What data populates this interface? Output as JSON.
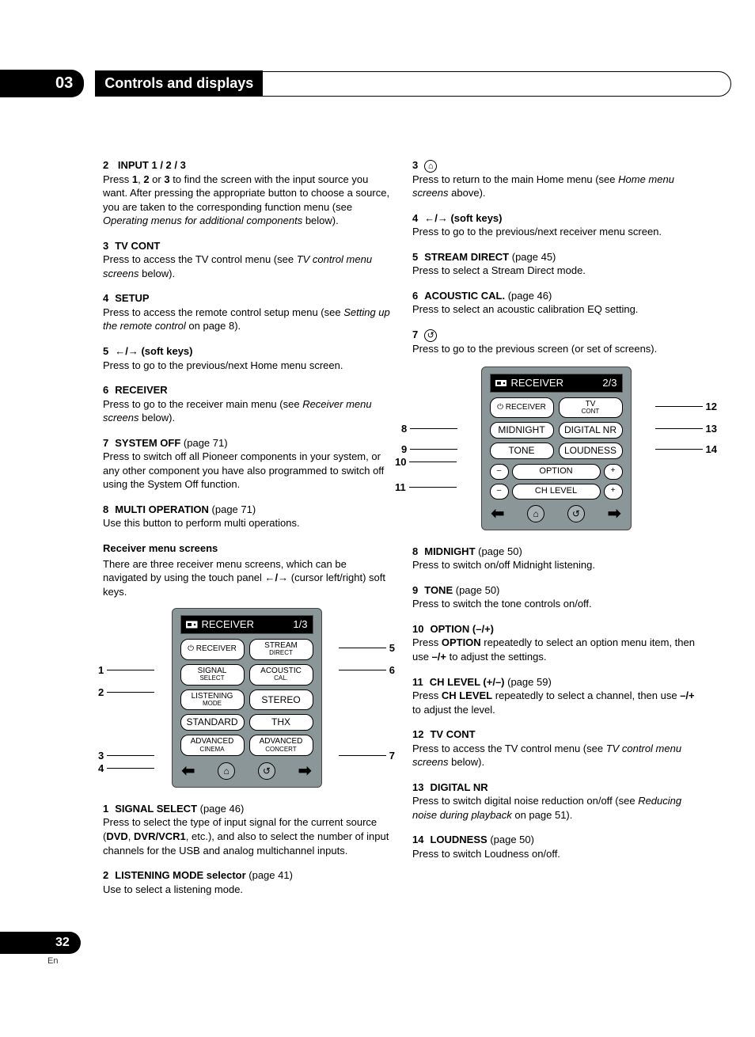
{
  "header": {
    "chapter_number": "03",
    "chapter_title": "Controls and displays"
  },
  "footer": {
    "page_number": "32",
    "lang": "En"
  },
  "left_col": {
    "i2": {
      "num": "2",
      "title": "INPUT 1 / 2 / 3",
      "body_a": "Press ",
      "b1": "1",
      "sep1": ", ",
      "b2": "2",
      "sep2": " or ",
      "b3": "3",
      "body_b": " to find the screen with the input source you want. After pressing the appropriate button to choose a source, you are taken to the corresponding function menu (see ",
      "ital": "Operating menus for additional components",
      "body_c": " below)."
    },
    "i3": {
      "num": "3",
      "title": "TV CONT",
      "body_a": "Press to access the TV control menu (see ",
      "ital": "TV control menu screens",
      "body_b": " below)."
    },
    "i4": {
      "num": "4",
      "title": "SETUP",
      "body_a": "Press to access the remote control setup menu (see ",
      "ital": "Setting up the remote control",
      "body_b": " on page 8)."
    },
    "i5": {
      "num": "5",
      "arrows": "←/→",
      "title_suffix": " (soft keys)",
      "body": "Press to go to the previous/next Home menu screen."
    },
    "i6": {
      "num": "6",
      "title": "RECEIVER",
      "body_a": "Press to go to the receiver main menu (see ",
      "ital": "Receiver menu screens",
      "body_b": " below)."
    },
    "i7": {
      "num": "7",
      "title": "SYSTEM OFF",
      "ref": " (page 71)",
      "body": "Press to switch off all Pioneer components in your system, or any other component you have also programmed to switch off using the System Off function."
    },
    "i8": {
      "num": "8",
      "title": "MULTI OPERATION",
      "ref": " (page 71)",
      "body": "Use this button to perform multi operations."
    },
    "section": {
      "title": "Receiver menu screens",
      "body_a": "There are three receiver menu screens, which can be navigated by using the touch panel ",
      "arrows": "←/→",
      "body_b": " (cursor left/right) soft keys."
    },
    "remote1": {
      "title": "RECEIVER",
      "page": "1/3",
      "btns": {
        "receiver": "RECEIVER",
        "stream_direct_a": "STREAM",
        "stream_direct_b": "DIRECT",
        "signal_select_a": "SIGNAL",
        "signal_select_b": "SELECT",
        "acoustic_cal_a": "ACOUSTIC",
        "acoustic_cal_b": "CAL.",
        "listening_mode_a": "LISTENING",
        "listening_mode_b": "MODE",
        "stereo": "STEREO",
        "standard": "STANDARD",
        "thx": "THX",
        "adv_cinema_a": "ADVANCED",
        "adv_cinema_b": "CINEMA",
        "adv_concert_a": "ADVANCED",
        "adv_concert_b": "CONCERT"
      },
      "callouts": {
        "c1": "1",
        "c2": "2",
        "c3": "3",
        "c4": "4",
        "c5": "5",
        "c6": "6",
        "c7": "7"
      }
    },
    "after_remote": {
      "i1": {
        "num": "1",
        "title": "SIGNAL SELECT",
        "ref": " (page 46)",
        "body_a": "Press to select the type of input signal for the current source (",
        "b1": "DVD",
        "sep1": ", ",
        "b2": "DVR/VCR1",
        "body_b": ", etc.), and also to select the number of input channels for the USB and analog multichannel inputs."
      },
      "i2b": {
        "num": "2",
        "title": "LISTENING MODE selector",
        "ref": " (page 41)",
        "body": "Use to select a listening mode."
      }
    }
  },
  "right_col": {
    "i3": {
      "num": "3",
      "body_a": "Press to return to the main Home menu (see ",
      "ital": "Home menu screens",
      "body_b": " above)."
    },
    "i4": {
      "num": "4",
      "arrows": "←/→",
      "title_suffix": " (soft keys)",
      "body": "Press to go to the previous/next receiver menu screen."
    },
    "i5": {
      "num": "5",
      "title": "STREAM DIRECT",
      "ref": " (page 45)",
      "body": "Press to select a Stream Direct mode."
    },
    "i6": {
      "num": "6",
      "title": "ACOUSTIC CAL.",
      "ref": " (page 46)",
      "body": "Press to select an acoustic calibration EQ setting."
    },
    "i7": {
      "num": "7",
      "body": "Press to go to the previous screen (or set of screens)."
    },
    "remote2": {
      "title": "RECEIVER",
      "page": "2/3",
      "btns": {
        "receiver": "RECEIVER",
        "tv_cont_a": "TV",
        "tv_cont_b": "CONT",
        "midnight": "MIDNIGHT",
        "digital_nr": "DIGITAL NR",
        "tone": "TONE",
        "loudness": "LOUDNESS",
        "option": "OPTION",
        "ch_level": "CH LEVEL",
        "minus": "–",
        "plus": "+"
      },
      "callouts": {
        "c8": "8",
        "c9": "9",
        "c10": "10",
        "c11": "11",
        "c12": "12",
        "c13": "13",
        "c14": "14"
      }
    },
    "i8": {
      "num": "8",
      "title": "MIDNIGHT",
      "ref": " (page 50)",
      "body": "Press to switch on/off Midnight listening."
    },
    "i9": {
      "num": "9",
      "title": "TONE",
      "ref": " (page 50)",
      "body": "Press to switch the tone controls on/off."
    },
    "i10": {
      "num": "10",
      "title": "OPTION (–/+)",
      "body_a": "Press ",
      "b1": "OPTION",
      "body_b": " repeatedly to select an option menu item, then use ",
      "b2": "–/+",
      "body_c": " to adjust the settings."
    },
    "i11": {
      "num": "11",
      "title": "CH LEVEL (+/–)",
      "ref": " (page 59)",
      "body_a": "Press ",
      "b1": "CH LEVEL",
      "body_b": " repeatedly to select a channel, then use ",
      "b2": "–/+",
      "body_c": " to adjust the level."
    },
    "i12": {
      "num": "12",
      "title": "TV CONT",
      "body_a": "Press to access the TV control menu (see ",
      "ital": "TV control menu screens",
      "body_b": " below)."
    },
    "i13": {
      "num": "13",
      "title": "DIGITAL NR",
      "body_a": "Press to switch digital noise reduction on/off (see ",
      "ital": "Reducing noise during playback",
      "body_b": " on page 51)."
    },
    "i14": {
      "num": "14",
      "title": "LOUDNESS",
      "ref": " (page 50)",
      "body": "Press to switch Loudness on/off."
    }
  }
}
